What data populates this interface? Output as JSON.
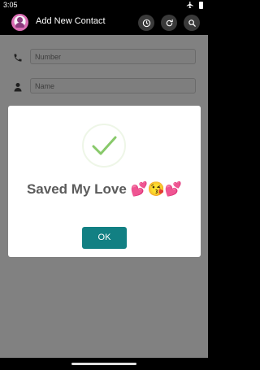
{
  "status_bar": {
    "time": "3:05"
  },
  "app_bar": {
    "title": "Add New Contact"
  },
  "form": {
    "number_placeholder": "Number",
    "name_placeholder": "Name"
  },
  "dialog": {
    "message": "Saved My Love 💕😘💕",
    "ok_label": "OK"
  },
  "colors": {
    "accent": "#128083",
    "check": "#88c96a",
    "overlay": "#818181"
  }
}
